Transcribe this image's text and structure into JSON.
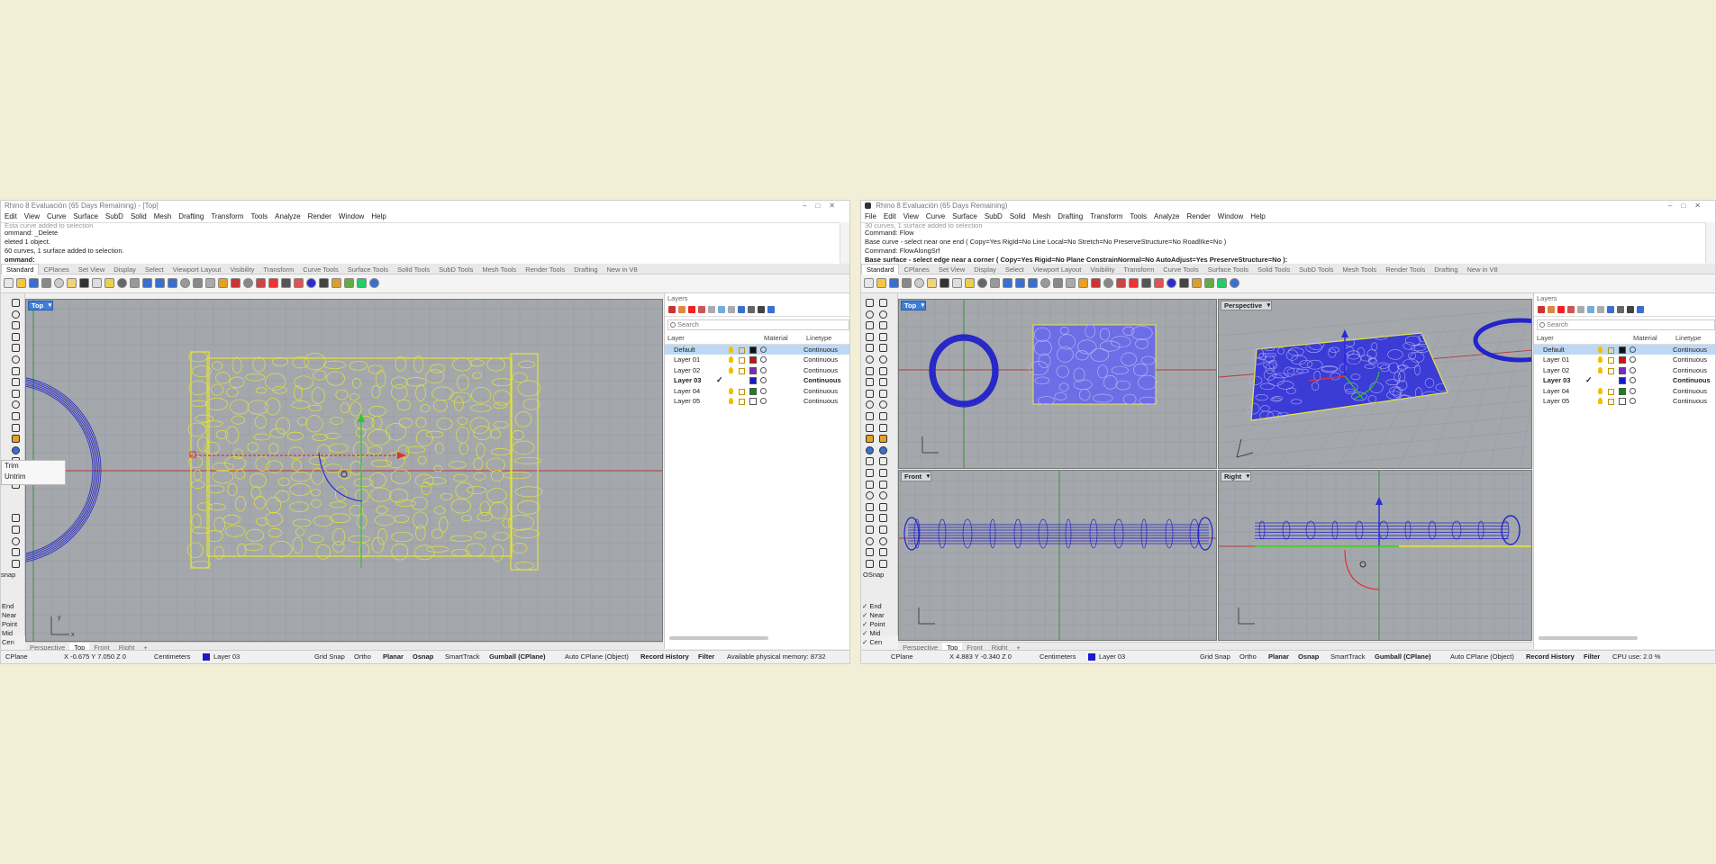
{
  "left": {
    "title": "Rhino 8 Evaluación (65 Days Remaining) - [Top]",
    "menu": [
      "Edit",
      "View",
      "Curve",
      "Surface",
      "SubD",
      "Solid",
      "Mesh",
      "Drafting",
      "Transform",
      "Tools",
      "Analyze",
      "Render",
      "Window",
      "Help"
    ],
    "command_lines": [
      "Esta curve added to selection",
      "ommand: _Delete",
      "eleted 1 object.",
      "60 curves, 1 surface added to selection."
    ],
    "command_prompt": "ommand:",
    "tabs": [
      "Standard",
      "CPlanes",
      "Set View",
      "Display",
      "Select",
      "Viewport Layout",
      "Visibility",
      "Transform",
      "Curve Tools",
      "Surface Tools",
      "Solid Tools",
      "SubD Tools",
      "Mesh Tools",
      "Render Tools",
      "Drafting",
      "New in V8"
    ],
    "viewport_label": "Top",
    "popup": [
      "Trim",
      "Untrim"
    ],
    "osnap_title": "snap",
    "osnap": [
      "End",
      "Near",
      "Point",
      "Mid",
      "Cen"
    ],
    "view_tabs": [
      "Perspective",
      "Top",
      "Front",
      "Right"
    ],
    "status": {
      "cplane": "CPlane",
      "coords": "X -0.675 Y 7.050 Z 0",
      "units": "Centimeters",
      "layer": "Layer 03",
      "grid": "Grid Snap",
      "ortho": "Ortho",
      "planar": "Planar",
      "osnap": "Osnap",
      "smarttrack": "SmartTrack",
      "gumball": "Gumball (CPlane)",
      "autocplane": "Auto CPlane (Object)",
      "record": "Record History",
      "filter": "Filter",
      "info": "Available physical memory: 8732"
    }
  },
  "right": {
    "title": "Rhino 8 Evaluación (65 Days Remaining)",
    "menu": [
      "File",
      "Edit",
      "View",
      "Curve",
      "Surface",
      "SubD",
      "Solid",
      "Mesh",
      "Drafting",
      "Transform",
      "Tools",
      "Analyze",
      "Render",
      "Window",
      "Help"
    ],
    "command_lines": [
      "30 curves, 1 surface added to selection",
      "Command: Flow",
      "Base curve - select near one end ( Copy=Yes  RigId=No  Line  Local=No  Stretch=No  PreserveStructure=No  RoadlIke=No )",
      "Command: FlowAlongSrf"
    ],
    "command_prompt": "Base surface - select edge near a corner ( Copy=Yes  Rigid=No  Plane  ConstrainNormal=No  AutoAdjust=Yes  PreserveStructure=No ):",
    "tabs": [
      "Standard",
      "CPlanes",
      "Set View",
      "Display",
      "Select",
      "Viewport Layout",
      "Visibility",
      "Transform",
      "Curve Tools",
      "Surface Tools",
      "Solid Tools",
      "SubD Tools",
      "Mesh Tools",
      "Render Tools",
      "Drafting",
      "New in V8"
    ],
    "viewports": [
      "Top",
      "Perspective",
      "Front",
      "Right"
    ],
    "osnap_title": "OSnap",
    "osnap": [
      "End",
      "Near",
      "Point",
      "Mid",
      "Cen"
    ],
    "view_tabs": [
      "Perspective",
      "Top",
      "Front",
      "Right"
    ],
    "status": {
      "cplane": "CPlane",
      "coords": "X 4.883 Y -0.340 Z 0",
      "units": "Centimeters",
      "layer": "Layer 03",
      "grid": "Grid Snap",
      "ortho": "Ortho",
      "planar": "Planar",
      "osnap": "Osnap",
      "smarttrack": "SmartTrack",
      "gumball": "Gumball (CPlane)",
      "autocplane": "Auto CPlane (Object)",
      "record": "Record History",
      "filter": "Filter",
      "info": "CPU use: 2.0 %"
    }
  },
  "layers_panel": {
    "title": "Layers",
    "search": "Search",
    "columns": [
      "Layer",
      "Material",
      "Linetype"
    ],
    "rows": [
      {
        "name": "Default",
        "linetype": "Continuous",
        "color": "#111111"
      },
      {
        "name": "Layer 01",
        "linetype": "Continuous",
        "color": "#cc1111"
      },
      {
        "name": "Layer 02",
        "linetype": "Continuous",
        "color": "#7a2bbf"
      },
      {
        "name": "Layer 03",
        "linetype": "Continuous",
        "color": "#1a1acc"
      },
      {
        "name": "Layer 04",
        "linetype": "Continuous",
        "color": "#118811"
      },
      {
        "name": "Layer 05",
        "linetype": "Continuous",
        "color": "#ffffff"
      }
    ]
  },
  "colors": {
    "viewport": "#a4a8ad",
    "active": "#3d7fd9",
    "blue_object": "#2a2ad8",
    "yellow_curves": "#e8e83a"
  }
}
